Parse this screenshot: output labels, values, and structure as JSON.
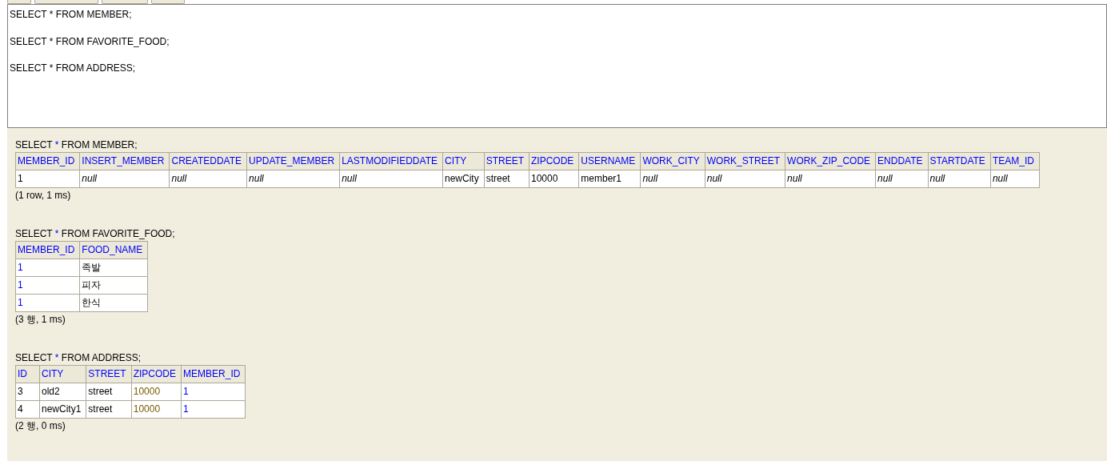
{
  "editor": {
    "lines": [
      "SELECT * FROM MEMBER;",
      "SELECT * FROM FAVORITE_FOOD;",
      "SELECT * FROM ADDRESS;"
    ]
  },
  "results": [
    {
      "query": {
        "keyword": "SELECT",
        "star": "*",
        "rest": "FROM MEMBER;"
      },
      "columns": [
        "MEMBER_ID",
        "INSERT_MEMBER",
        "CREATEDDATE",
        "UPDATE_MEMBER",
        "LASTMODIFIEDDATE",
        "CITY",
        "STREET",
        "ZIPCODE",
        "USERNAME",
        "WORK_CITY",
        "WORK_STREET",
        "WORK_ZIP_CODE",
        "ENDDATE",
        "STARTDATE",
        "TEAM_ID"
      ],
      "rows": [
        [
          {
            "text": "1",
            "kind": "plain"
          },
          {
            "text": "null",
            "kind": "null"
          },
          {
            "text": "null",
            "kind": "null"
          },
          {
            "text": "null",
            "kind": "null"
          },
          {
            "text": "null",
            "kind": "null"
          },
          {
            "text": "newCity",
            "kind": "plain"
          },
          {
            "text": "street",
            "kind": "plain"
          },
          {
            "text": "10000",
            "kind": "plain"
          },
          {
            "text": "member1",
            "kind": "plain"
          },
          {
            "text": "null",
            "kind": "null"
          },
          {
            "text": "null",
            "kind": "null"
          },
          {
            "text": "null",
            "kind": "null"
          },
          {
            "text": "null",
            "kind": "null"
          },
          {
            "text": "null",
            "kind": "null"
          },
          {
            "text": "null",
            "kind": "null"
          }
        ]
      ],
      "status": "(1 row, 1 ms)"
    },
    {
      "query": {
        "keyword": "SELECT",
        "star": "*",
        "rest": "FROM FAVORITE_FOOD;"
      },
      "columns": [
        "MEMBER_ID",
        "FOOD_NAME"
      ],
      "rows": [
        [
          {
            "text": "1",
            "kind": "link"
          },
          {
            "text": "족발",
            "kind": "plain"
          }
        ],
        [
          {
            "text": "1",
            "kind": "link"
          },
          {
            "text": "피자",
            "kind": "plain"
          }
        ],
        [
          {
            "text": "1",
            "kind": "link"
          },
          {
            "text": "한식",
            "kind": "plain"
          }
        ]
      ],
      "status": "(3 행, 1 ms)"
    },
    {
      "query": {
        "keyword": "SELECT",
        "star": "*",
        "rest": "FROM ADDRESS;"
      },
      "columns": [
        "ID",
        "CITY",
        "STREET",
        "ZIPCODE",
        "MEMBER_ID"
      ],
      "rows": [
        [
          {
            "text": "3",
            "kind": "plain"
          },
          {
            "text": "old2",
            "kind": "plain"
          },
          {
            "text": "street",
            "kind": "plain"
          },
          {
            "text": "10000",
            "kind": "number"
          },
          {
            "text": "1",
            "kind": "link"
          }
        ],
        [
          {
            "text": "4",
            "kind": "plain"
          },
          {
            "text": "newCity1",
            "kind": "plain"
          },
          {
            "text": "street",
            "kind": "plain"
          },
          {
            "text": "10000",
            "kind": "number"
          },
          {
            "text": "1",
            "kind": "link"
          }
        ]
      ],
      "status": "(2 행, 0 ms)"
    }
  ]
}
